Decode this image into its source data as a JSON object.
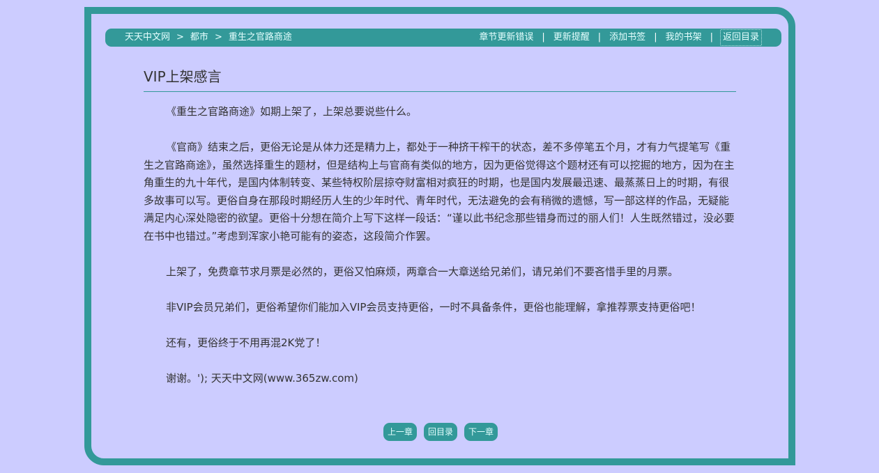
{
  "breadcrumb": {
    "items": [
      "天天中文网",
      "都市",
      "重生之官路商途"
    ],
    "separator": ">"
  },
  "nav": {
    "links": [
      "章节更新错误",
      "更新提醒",
      "添加书签",
      "我的书架",
      "返回目录"
    ],
    "separator": "|"
  },
  "chapter": {
    "title": "VIP上架感言",
    "paragraphs": [
      "《重生之官路商途》如期上架了，上架总要说些什么。",
      "《官商》结束之后，更俗无论是从体力还是精力上，都处于一种挤干榨干的状态，差不多停笔五个月，才有力气提笔写《重生之官路商途》，虽然选择重生的题材，但是结构上与官商有类似的地方，因为更俗觉得这个题材还有可以挖掘的地方，因为在主角重生的九十年代，是国内体制转变、某些特权阶层掠夺财富相对疯狂的时期，也是国内发展最迅速、最蒸蒸日上的时期，有很多故事可以写。更俗自身在那段时期经历人生的少年时代、青年时代，无法避免的会有稍微的遗憾，写一部这样的作品，无疑能满足内心深处隐密的欲望。更俗十分想在简介上写下这样一段话：“谨以此书纪念那些错身而过的丽人们！人生既然错过，没必要在书中也错过。”考虑到浑家小艳可能有的姿态，这段简介作罢。",
      "上架了，免费章节求月票是必然的，更俗又怕麻烦，两章合一大章送给兄弟们，请兄弟们不要吝惜手里的月票。",
      "非VIP会员兄弟们，更俗希望你们能加入VIP会员支持更俗，一时不具备条件，更俗也能理解，拿推荐票支持更俗吧！",
      "还有，更俗终于不用再混2K党了！",
      "谢谢。'); 天天中文网(www.365zw.com)"
    ]
  },
  "pager": {
    "prev": "上一章",
    "index": "回目录",
    "next": "下一章"
  },
  "colors": {
    "background": "#ccccff",
    "accent": "#339999",
    "text": "#333333"
  }
}
